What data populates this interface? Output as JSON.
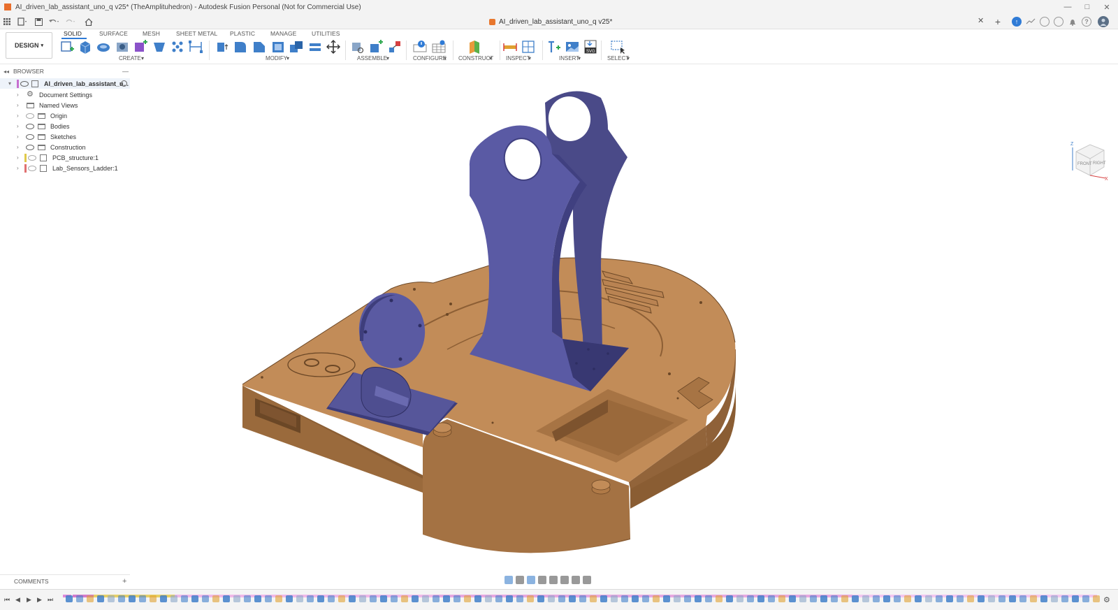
{
  "window": {
    "title": "AI_driven_lab_assistant_uno_q v25* (TheAmplituhedron) - Autodesk Fusion Personal (Not for Commercial Use)",
    "minimize": "—",
    "maximize": "□",
    "close": "✕"
  },
  "tabbar": {
    "document_tab": "AI_driven_lab_assistant_uno_q v25*",
    "close_glyph": "✕",
    "new_tab_glyph": "+"
  },
  "toolbar": {
    "workspace": "DESIGN",
    "tabs": [
      "SOLID",
      "SURFACE",
      "MESH",
      "SHEET METAL",
      "PLASTIC",
      "MANAGE",
      "UTILITIES"
    ],
    "groups": [
      "CREATE",
      "MODIFY",
      "ASSEMBLE",
      "CONFIGURE",
      "CONSTRUCT",
      "INSPECT",
      "INSERT",
      "SELECT"
    ]
  },
  "browser": {
    "title": "BROWSER",
    "root": "AI_driven_lab_assistant_u...",
    "items": [
      {
        "label": "Document Settings"
      },
      {
        "label": "Named Views"
      },
      {
        "label": "Origin"
      },
      {
        "label": "Bodies"
      },
      {
        "label": "Sketches"
      },
      {
        "label": "Construction"
      },
      {
        "label": "PCB_structure:1"
      },
      {
        "label": "Lab_Sensors_Ladder:1"
      }
    ]
  },
  "comments": {
    "title": "COMMENTS",
    "add_glyph": "+"
  },
  "colors": {
    "accent": "#2f7bd6",
    "body_tan": "#b98352",
    "body_purple": "#5a5a98",
    "title_bar": "#f3f3f3"
  },
  "viewcube": {
    "front": "FRONT",
    "right": "RIGHT",
    "axis_z": "Z",
    "axis_x": "X"
  }
}
